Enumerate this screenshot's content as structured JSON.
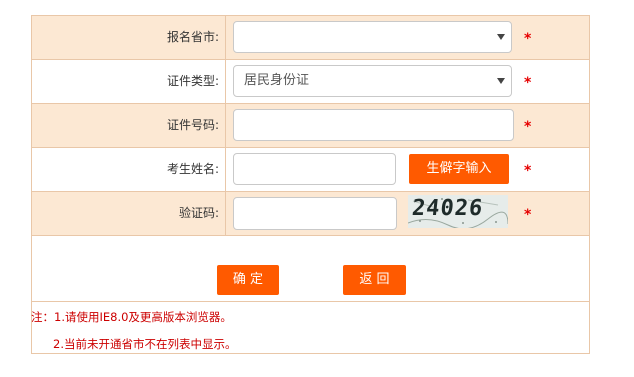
{
  "form": {
    "province": {
      "label": "报名省市:",
      "value": ""
    },
    "id_type": {
      "label": "证件类型:",
      "value": "居民身份证"
    },
    "id_number": {
      "label": "证件号码:",
      "value": ""
    },
    "name": {
      "label": "考生姓名:",
      "value": "",
      "rare_char_button": "生僻字输入"
    },
    "captcha": {
      "label": "验证码:",
      "value": "",
      "code": "24026"
    },
    "required_mark": "*"
  },
  "buttons": {
    "confirm": "确 定",
    "back": "返 回"
  },
  "notes": {
    "line1": "注：1.请使用IE8.0及更高版本浏览器。",
    "line2": "2.当前未开通省市不在列表中显示。"
  },
  "colors": {
    "accent": "#ff5a00",
    "row_shade": "#fce8d3",
    "border": "#e9c7a8",
    "required": "#e60000",
    "note": "#cc0000"
  }
}
